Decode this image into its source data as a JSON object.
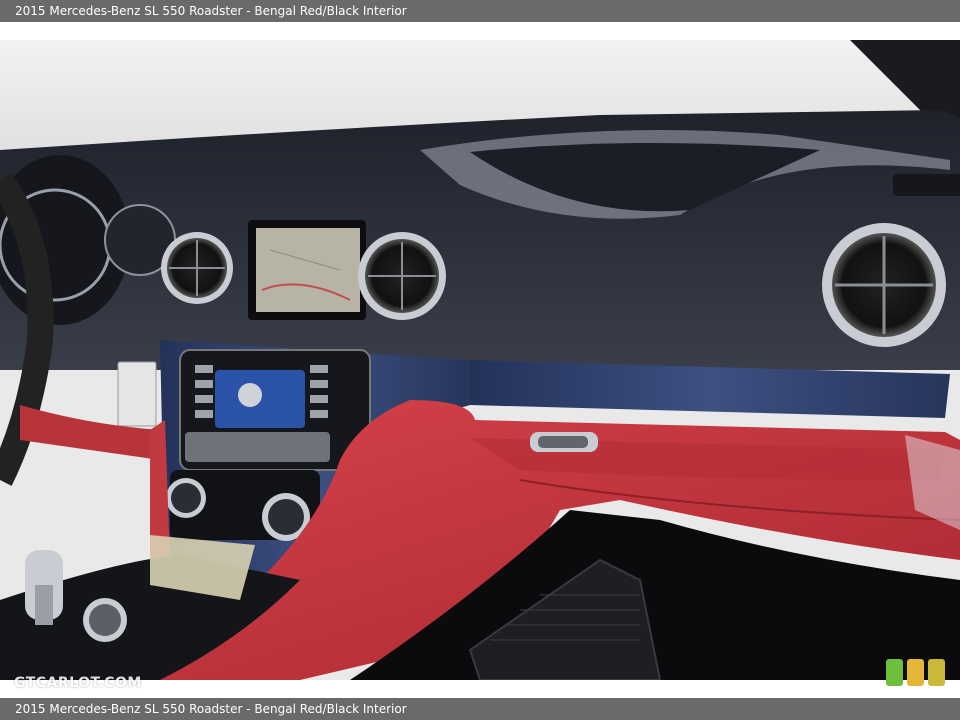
{
  "caption": {
    "text": "2015 Mercedes-Benz SL 550 Roadster - Bengal Red/Black Interior"
  },
  "watermark": {
    "text": "GTCARLOT.COM"
  },
  "photo": {
    "description_colors": {
      "dash_top": "#2a2d36",
      "leather_red": "#c0333b",
      "trim_blue": "#2f3e64",
      "chrome": "#c9ccd2",
      "sky": "#e7e7e7"
    }
  },
  "badges": {
    "colors": [
      "#6fbf3f",
      "#e3b63a",
      "#cbb83a"
    ]
  }
}
